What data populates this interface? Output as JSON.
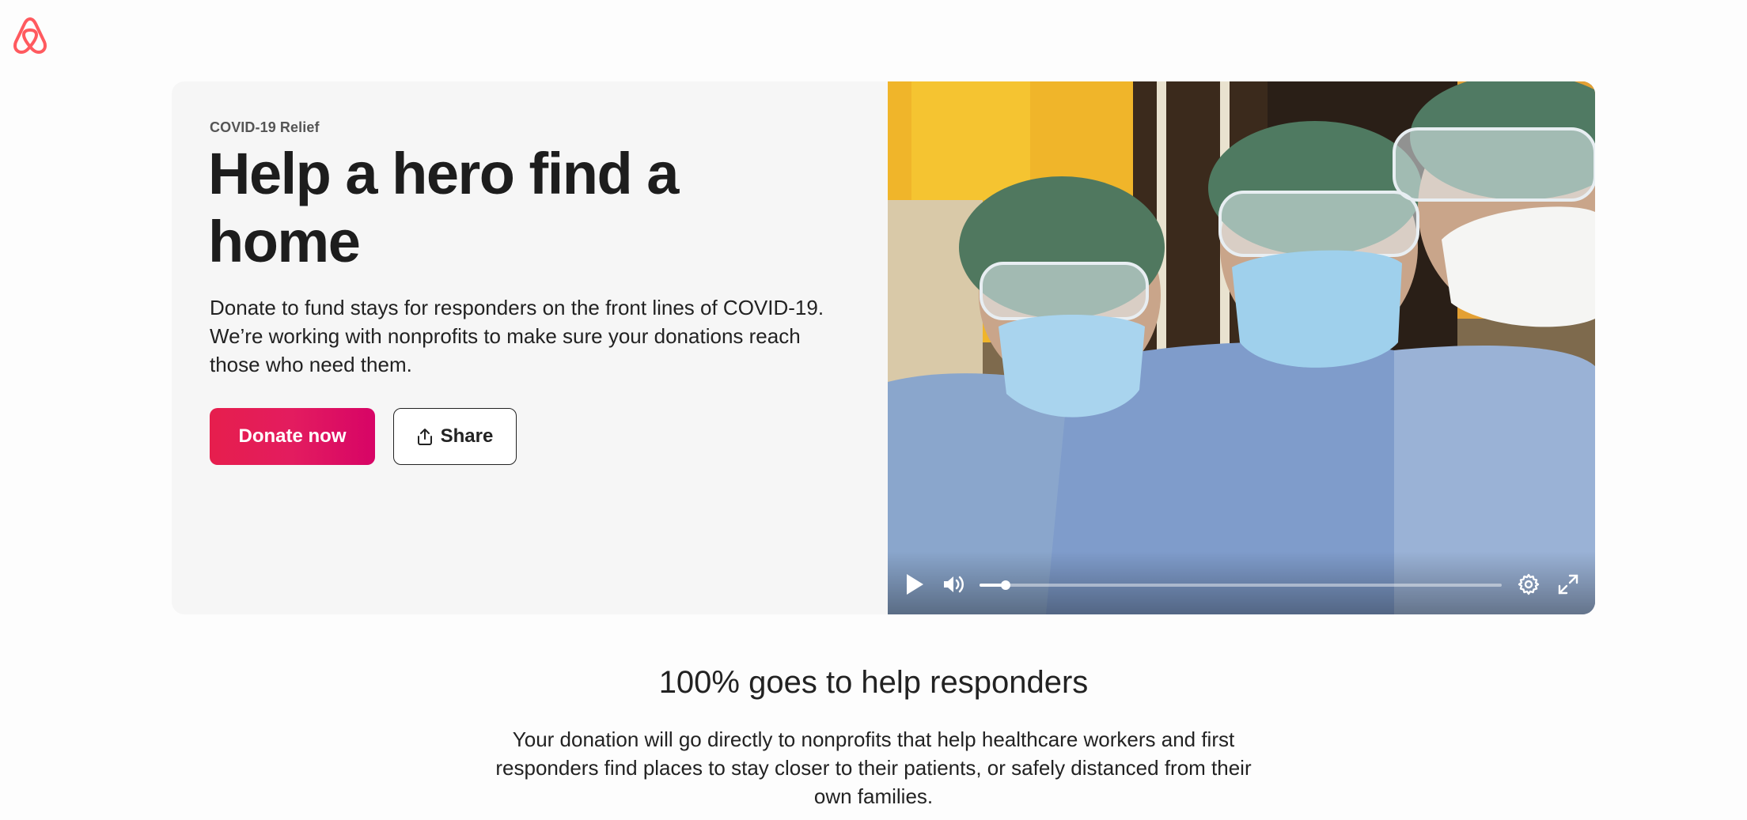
{
  "brand": {
    "logo_icon": "airbnb-belo-icon",
    "color": "#ff5a5f"
  },
  "hero": {
    "eyebrow": "COVID-19 Relief",
    "headline": "Help a hero find a home",
    "description": "Donate to fund stays for responders on the front lines of COVID-19. We’re working with nonprofits to make sure your donations reach those who need them.",
    "donate_label": "Donate now",
    "donate_color": "#e31c5f",
    "share_label": "Share",
    "share_icon": "share-upload-icon"
  },
  "video": {
    "controls": {
      "play_icon": "play-icon",
      "volume_icon": "volume-icon",
      "settings_icon": "gear-icon",
      "fullscreen_icon": "fullscreen-icon",
      "progress": 0.05
    }
  },
  "section": {
    "title": "100% goes to help responders",
    "description": "Your donation will go directly to nonprofits that help healthcare workers and first responders find places to stay closer to their patients, or safely distanced from their own families."
  }
}
